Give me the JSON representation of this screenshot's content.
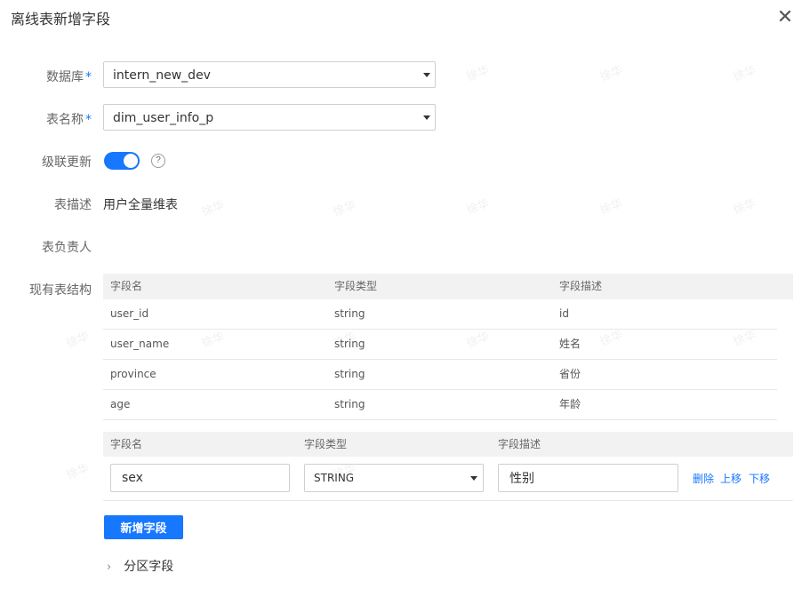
{
  "dialog": {
    "title": "离线表新增字段",
    "close_icon": "close-icon"
  },
  "watermark": {
    "text": "徐华"
  },
  "form": {
    "database": {
      "label": "数据库",
      "required_mark": "*",
      "value": "intern_new_dev"
    },
    "table_name": {
      "label": "表名称",
      "required_mark": "*",
      "value": "dim_user_info_p"
    },
    "cascade_update": {
      "label": "级联更新",
      "enabled": true,
      "help_icon": "question-icon",
      "help_glyph": "?"
    },
    "table_description": {
      "label": "表描述",
      "value": "用户全量维表"
    },
    "table_owner": {
      "label": "表负责人",
      "value": ""
    },
    "existing_schema": {
      "label": "现有表结构",
      "columns": [
        "字段名",
        "字段类型",
        "字段描述"
      ],
      "rows": [
        [
          "user_id",
          "string",
          "id"
        ],
        [
          "user_name",
          "string",
          "姓名"
        ],
        [
          "province",
          "string",
          "省份"
        ],
        [
          "age",
          "string",
          "年龄"
        ]
      ]
    }
  },
  "new_field": {
    "columns": [
      "字段名",
      "字段类型",
      "字段描述"
    ],
    "row": {
      "name": "sex",
      "type": "STRING",
      "description": "性别",
      "actions": {
        "delete": "删除",
        "move_up": "上移",
        "move_down": "下移"
      }
    }
  },
  "add_field_button": "新增字段",
  "partition_section": {
    "label": "分区字段",
    "chevron_glyph": "›"
  },
  "colors": {
    "primary": "#1677ff",
    "header_bg": "#f2f2f2",
    "border": "#cfcfcf"
  }
}
